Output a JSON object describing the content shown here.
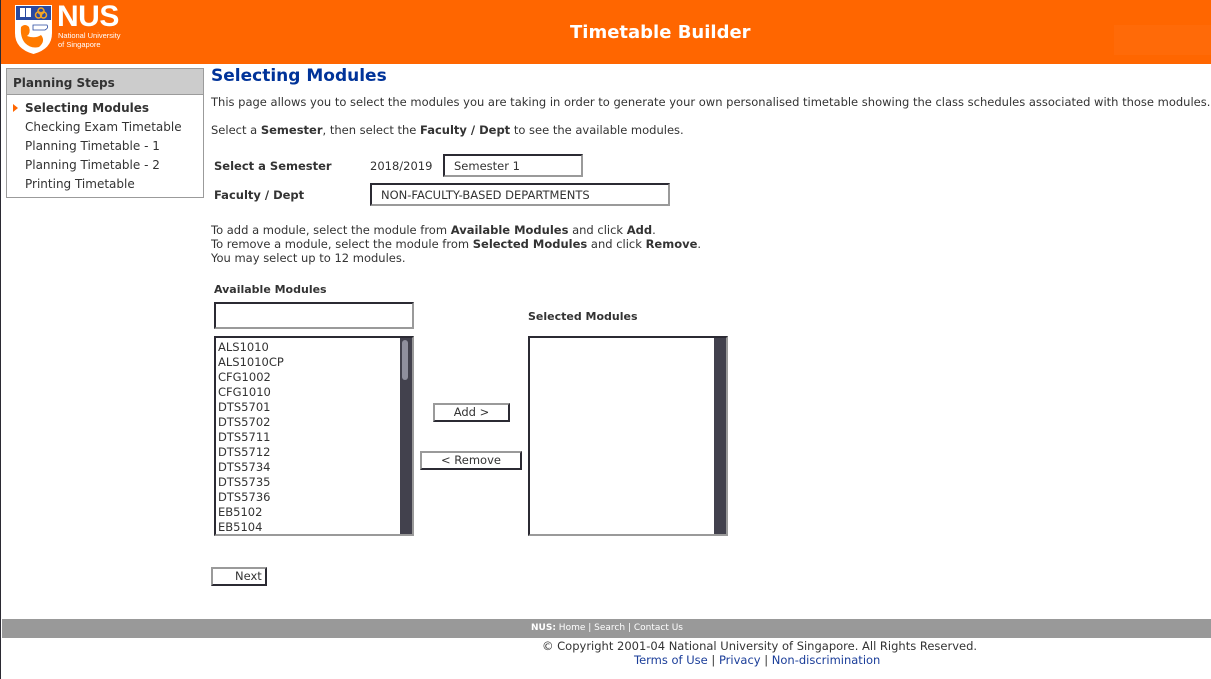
{
  "header": {
    "logo_text": "NUS",
    "logo_subtitle_line1": "National University",
    "logo_subtitle_line2": "of Singapore",
    "app_title": "Timetable Builder",
    "brand_color": "#ff6600"
  },
  "sidebar": {
    "title": "Planning Steps",
    "items": [
      {
        "label": "Selecting Modules",
        "active": true
      },
      {
        "label": "Checking Exam Timetable",
        "active": false
      },
      {
        "label": "Planning Timetable - 1",
        "active": false
      },
      {
        "label": "Planning Timetable - 2",
        "active": false
      },
      {
        "label": "Printing Timetable",
        "active": false
      }
    ]
  },
  "main": {
    "title": "Selecting Modules",
    "intro": "This page allows you to select the modules you are taking in order to generate your own personalised timetable showing the class schedules associated with those modules.",
    "instruction": {
      "p1": "Select a ",
      "b1": "Semester",
      "p2": ", then select the ",
      "b2": "Faculty / Dept",
      "p3": " to see the available modules."
    },
    "semester_label": "Select a Semester",
    "academic_year": "2018/2019",
    "semester_value": "Semester 1",
    "faculty_label": "Faculty / Dept",
    "faculty_value": "NON-FACULTY-BASED DEPARTMENTS",
    "help": {
      "add_p1": "To add a module, select the module from ",
      "add_b1": "Available Modules",
      "add_p2": " and click ",
      "add_b2": "Add",
      "add_p3": ".",
      "remove_p1": "To remove a module, select the module from ",
      "remove_b1": "Selected Modules",
      "remove_p2": " and click ",
      "remove_b2": "Remove",
      "remove_p3": ".",
      "limit": "You may select up to 12 modules."
    },
    "available_label": "Available Modules",
    "search_value": "",
    "available_modules": [
      "ALS1010",
      "ALS1010CP",
      "CFG1002",
      "CFG1010",
      "DTS5701",
      "DTS5702",
      "DTS5711",
      "DTS5712",
      "DTS5734",
      "DTS5735",
      "DTS5736",
      "EB5102",
      "EB5104"
    ],
    "selected_label": "Selected Modules",
    "selected_modules": [],
    "add_button": "Add >",
    "remove_button": "< Remove",
    "next_button": "Next >"
  },
  "footer": {
    "nus_label": "NUS:",
    "links": [
      "Home",
      "Search",
      "Contact Us"
    ],
    "copyright": "© Copyright 2001-04 National University of Singapore. All Rights Reserved.",
    "legal_links": [
      "Terms of Use",
      "Privacy",
      "Non-discrimination"
    ]
  }
}
